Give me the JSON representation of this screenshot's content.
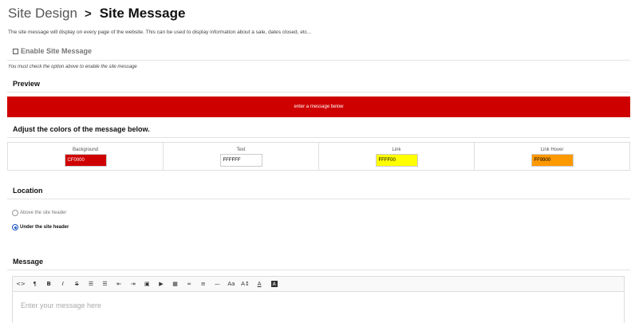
{
  "breadcrumb": {
    "parent": "Site Design",
    "separator": ">",
    "current": "Site Message"
  },
  "description": "The site message will display on every page of the website. This can be used to display information about a sale, dates closed, etc...",
  "enable": {
    "label": "Enable Site Message",
    "checked": false
  },
  "note": "You must check the option above to enable the site message",
  "preview": {
    "title": "Preview",
    "text": "enter a message below",
    "background": "#CF0000",
    "text_color": "#FFFFFF"
  },
  "colors": {
    "title": "Adjust the colors of the message below.",
    "fields": [
      {
        "label": "Background",
        "value": "CF0000",
        "swatch": "#CF0000",
        "text_color": "#FFFFFF"
      },
      {
        "label": "Text",
        "value": "FFFFFF",
        "swatch": "#FFFFFF",
        "text_color": "#000000"
      },
      {
        "label": "Link",
        "value": "FFFF00",
        "swatch": "#FFFF00",
        "text_color": "#000000"
      },
      {
        "label": "Link Hover",
        "value": "FF9900",
        "swatch": "#FF9900",
        "text_color": "#000000"
      }
    ]
  },
  "location": {
    "title": "Location",
    "options": [
      {
        "label": "Above the site header",
        "selected": false
      },
      {
        "label": "Under the site header",
        "selected": true
      }
    ]
  },
  "message": {
    "title": "Message",
    "placeholder": "Enter your message here",
    "toolbar": [
      {
        "name": "code-view-icon",
        "glyph": "<>"
      },
      {
        "name": "paragraph-icon",
        "glyph": "¶"
      },
      {
        "name": "bold-icon",
        "glyph": "B"
      },
      {
        "name": "italic-icon",
        "glyph": "I"
      },
      {
        "name": "strikethrough-icon",
        "glyph": "S"
      },
      {
        "name": "bulleted-list-icon",
        "glyph": "☰"
      },
      {
        "name": "numbered-list-icon",
        "glyph": "☰"
      },
      {
        "name": "outdent-icon",
        "glyph": "⇤"
      },
      {
        "name": "indent-icon",
        "glyph": "⇥"
      },
      {
        "name": "image-icon",
        "glyph": "▣"
      },
      {
        "name": "video-icon",
        "glyph": "▶"
      },
      {
        "name": "table-icon",
        "glyph": "▦"
      },
      {
        "name": "link-icon",
        "glyph": "∞"
      },
      {
        "name": "align-icon",
        "glyph": "≡"
      },
      {
        "name": "horizontal-rule-icon",
        "glyph": "—"
      },
      {
        "name": "font-size-icon",
        "glyph": "Aa"
      },
      {
        "name": "line-height-icon",
        "glyph": "A↕"
      },
      {
        "name": "font-color-icon",
        "glyph": "A"
      },
      {
        "name": "background-color-icon",
        "glyph": "A"
      }
    ]
  }
}
